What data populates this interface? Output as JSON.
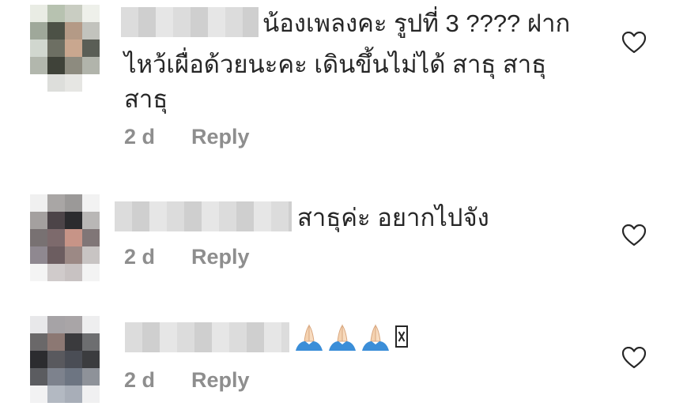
{
  "comments": [
    {
      "text_line1": "น้องเพลงคะ  รูปที่ 3 ???? ฝาก",
      "text_line2": "ไหว้เผื่อด้วยนะคะ  เดินขึ้นไม่ได้  สาธุ สาธุ",
      "text_line3": "สาธุ",
      "time": "2 d",
      "reply": "Reply",
      "icon": "heart-icon"
    },
    {
      "text_line1": "สาธุค่ะ อยากไปจัง",
      "time": "2 d",
      "reply": "Reply",
      "icon": "heart-icon"
    },
    {
      "emoji": [
        "folded-hands",
        "folded-hands",
        "folded-hands"
      ],
      "time": "2 d",
      "reply": "Reply",
      "icon": "heart-icon"
    }
  ],
  "colors": {
    "text": "#262626",
    "meta": "#8e8e8e",
    "emoji_sleeve": "#3b8ed8",
    "emoji_hand": "#f4d2b0"
  }
}
